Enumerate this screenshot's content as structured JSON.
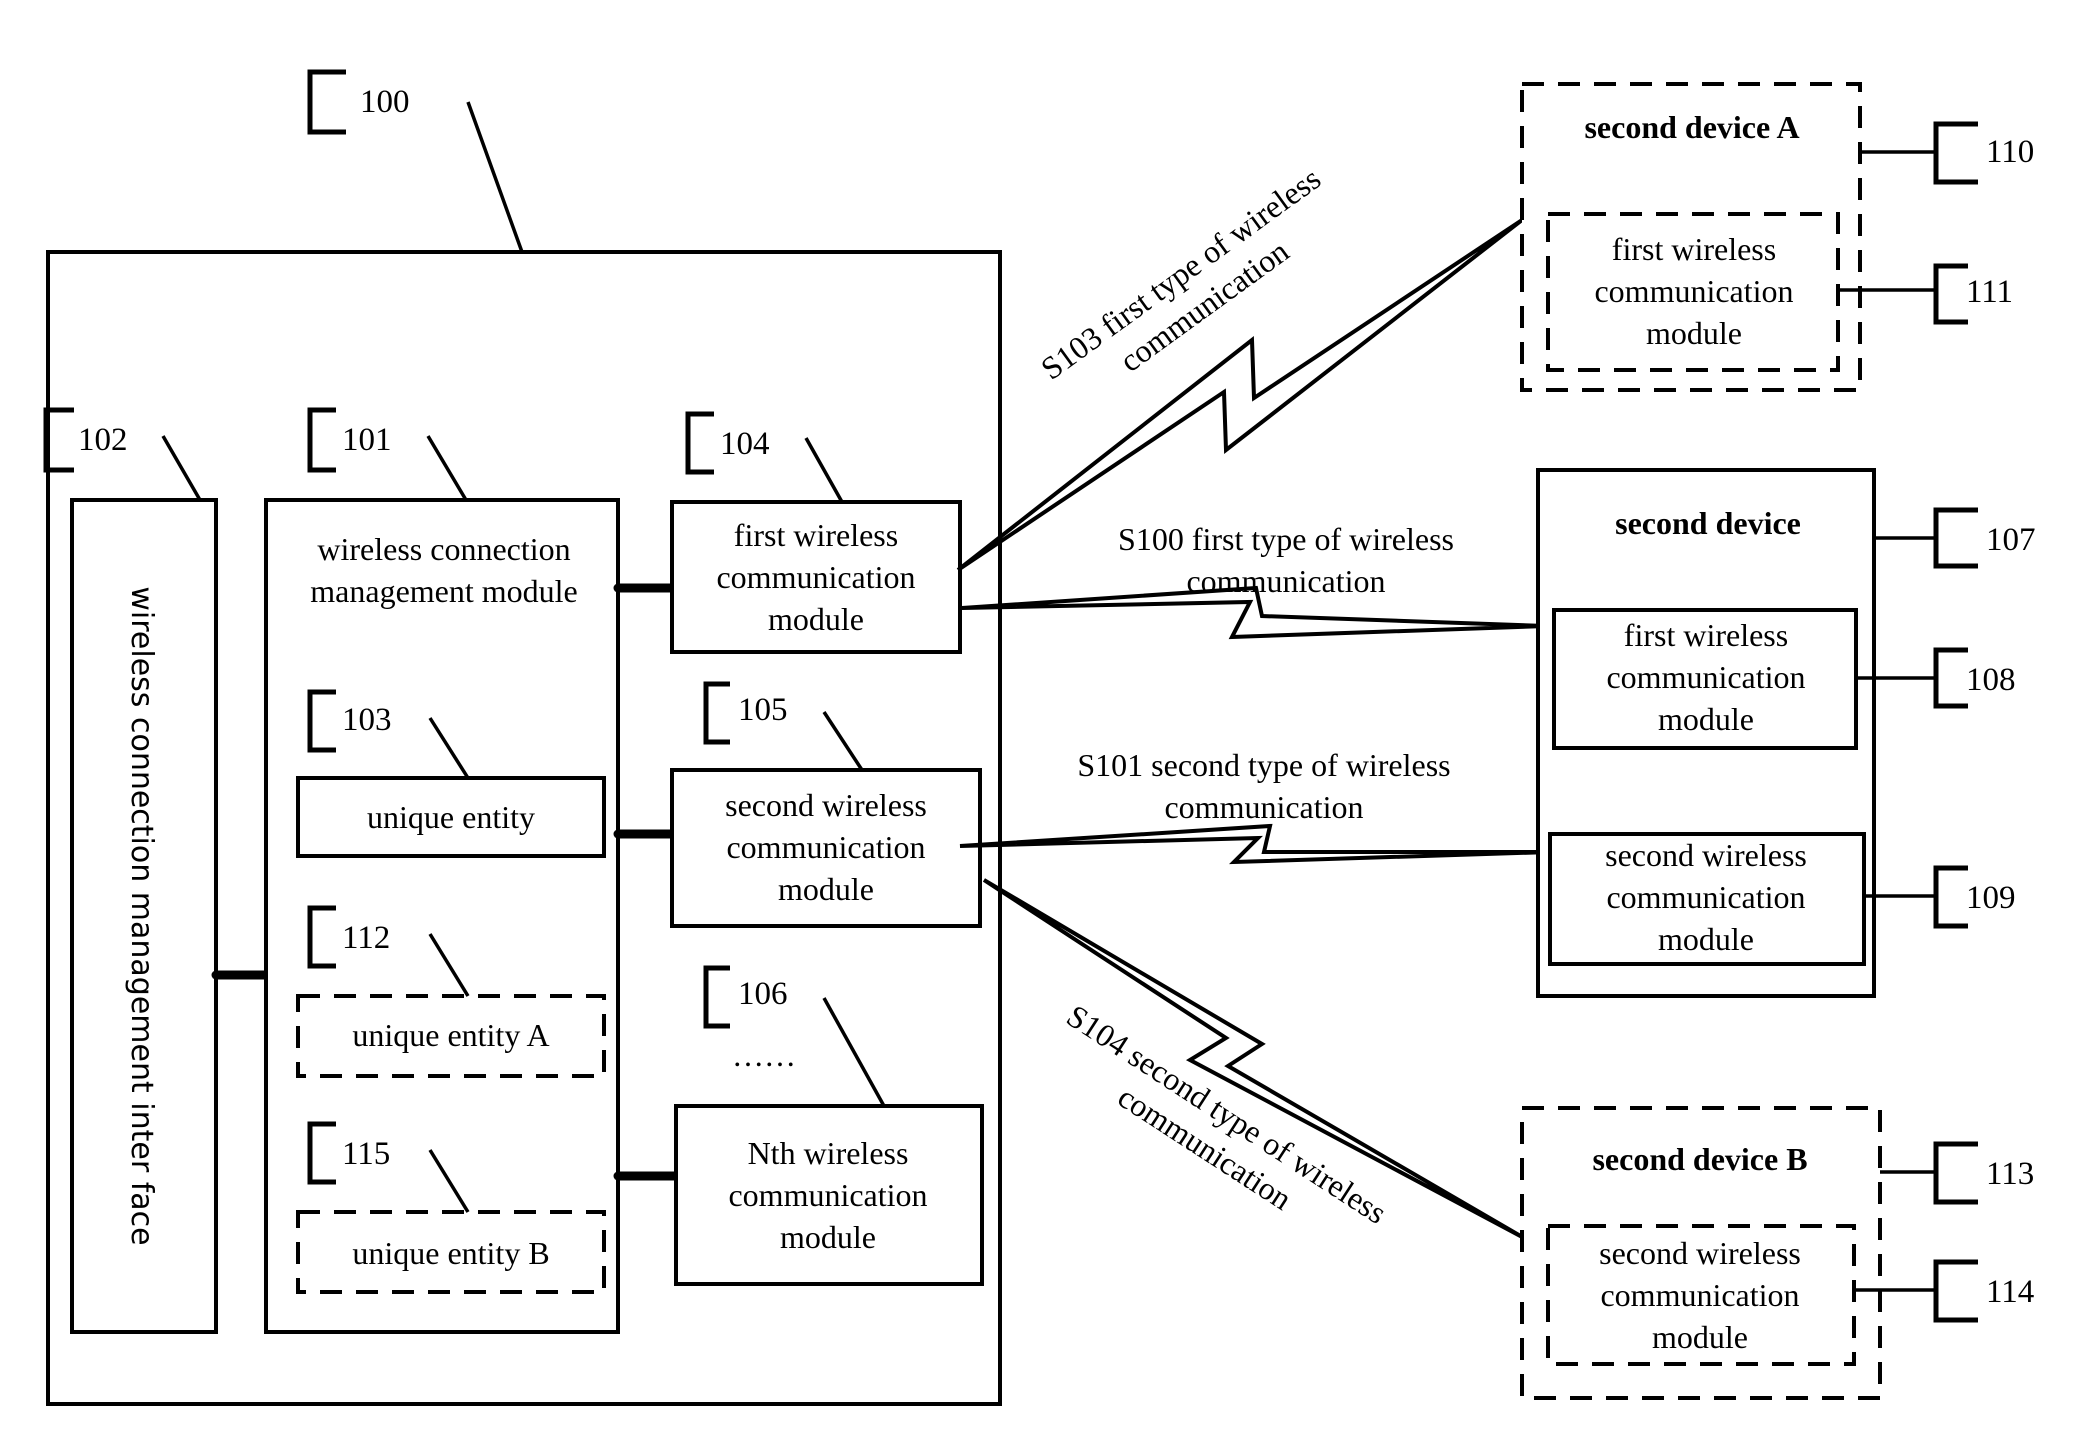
{
  "diagram": {
    "first_device": {
      "ref": "100",
      "interface": {
        "ref": "102",
        "label": "wireless connection management inter face"
      },
      "management_module": {
        "ref": "101",
        "label_lines": [
          "wireless connection",
          "management module"
        ],
        "entities": [
          {
            "ref": "103",
            "label": "unique entity",
            "style": "solid"
          },
          {
            "ref": "112",
            "label": "unique entity A",
            "style": "dashed"
          },
          {
            "ref": "115",
            "label": "unique entity B",
            "style": "dashed"
          }
        ]
      },
      "comm_modules": [
        {
          "ref": "104",
          "label_lines": [
            "first wireless",
            "communication",
            "module"
          ]
        },
        {
          "ref": "105",
          "label_lines": [
            "second wireless",
            "communication",
            "module"
          ]
        },
        {
          "ref": "106",
          "label_lines": [
            "Nth wireless",
            "communication",
            "module"
          ]
        }
      ],
      "ellipsis": "……"
    },
    "second_device_a": {
      "ref": "110",
      "title": "second device A",
      "module": {
        "ref": "111",
        "label_lines": [
          "first wireless",
          "communication",
          "module"
        ]
      }
    },
    "second_device": {
      "ref": "107",
      "title": "second device",
      "modules": [
        {
          "ref": "108",
          "label_lines": [
            "first wireless",
            "communication",
            "module"
          ]
        },
        {
          "ref": "109",
          "label_lines": [
            "second wireless",
            "communication",
            "module"
          ]
        }
      ]
    },
    "second_device_b": {
      "ref": "113",
      "title": "second device B",
      "module": {
        "ref": "114",
        "label_lines": [
          "second wireless",
          "communication",
          "module"
        ]
      }
    },
    "links": [
      {
        "step": "S103",
        "label_lines": [
          "S103 first type of wireless",
          "communication"
        ]
      },
      {
        "step": "S100",
        "label_lines": [
          "S100 first type of wireless",
          "communication"
        ]
      },
      {
        "step": "S101",
        "label_lines": [
          "S101 second type of wireless",
          "communication"
        ]
      },
      {
        "step": "S104",
        "label_lines": [
          "S104 second type of wireless",
          "communication"
        ]
      }
    ]
  }
}
